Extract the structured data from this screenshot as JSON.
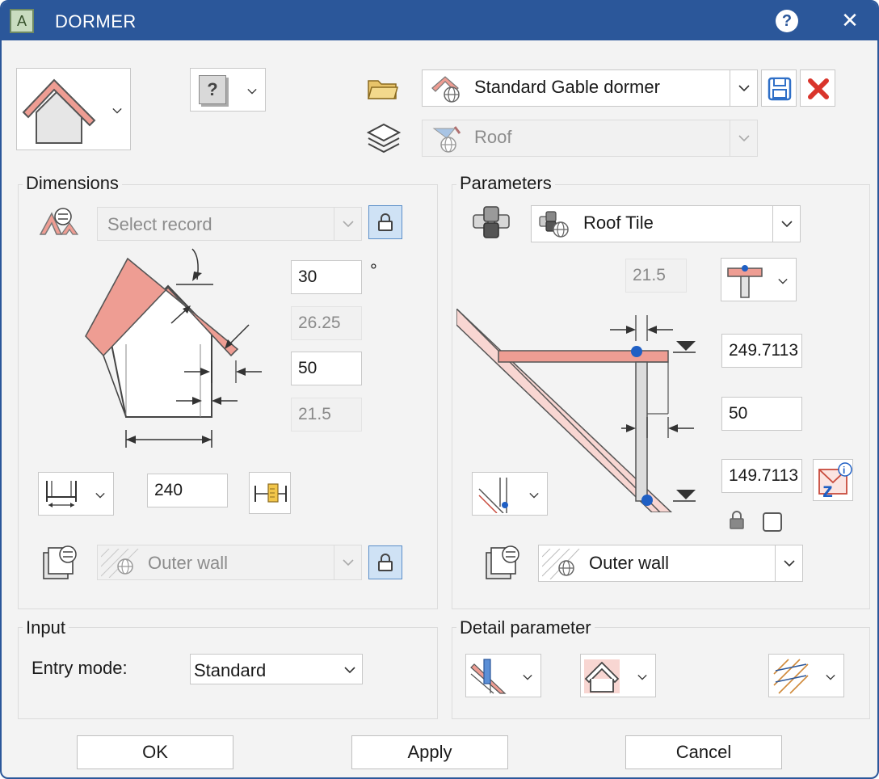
{
  "window": {
    "title": "DORMER",
    "app_icon_letter": "A",
    "help_icon": "?",
    "close_icon": "✕"
  },
  "top": {
    "favorite_name": "Standard Gable dormer",
    "layer_name": "Roof",
    "unknown_glyph": "?"
  },
  "dimensions": {
    "label": "Dimensions",
    "record_placeholder": "Select record",
    "angle_value": "30",
    "angle_unit": "°",
    "derived_1": "26.25",
    "offset_value": "50",
    "derived_2": "21.5",
    "width_value": "240",
    "wall_material": "Outer wall"
  },
  "parameters": {
    "label": "Parameters",
    "roof_material": "Roof Tile",
    "readonly_value": "21.5",
    "top_height": "249.7113",
    "thickness": "50",
    "bottom_height": "149.7113",
    "wall_material": "Outer wall"
  },
  "input": {
    "label": "Input",
    "entry_mode_label": "Entry mode:",
    "entry_mode_value": "Standard"
  },
  "detail": {
    "label": "Detail parameter"
  },
  "buttons": {
    "ok": "OK",
    "apply": "Apply",
    "cancel": "Cancel"
  },
  "colors": {
    "titlebar": "#2b579a",
    "roof": "#ee9d93",
    "lock_bg": "#cfe2f5",
    "delete_red": "#d9342b",
    "point_blue": "#1f5fc4"
  }
}
